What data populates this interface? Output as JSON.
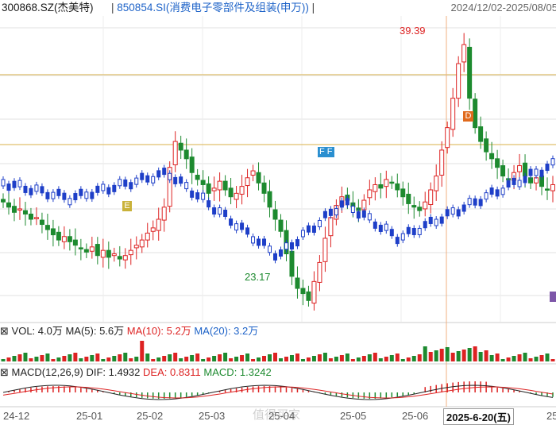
{
  "header": {
    "stock": "300868.SZ(杰美特)",
    "sep1": "|",
    "index": "850854.SI(消费电子零部件及组装(申万))",
    "sep2": "|",
    "range": "2024/12/02-2025/08/05"
  },
  "vol_panel": {
    "label": "VOL: 4.0万",
    "ma5": "MA(5): 5.6万",
    "ma10": "MA(10): 5.2万",
    "ma20": "MA(20): 3.2万",
    "prefix": "⊠"
  },
  "macd_panel": {
    "prefix": "⊠",
    "label": "MACD(12,26,9)",
    "dif": "DIF: 1.4932",
    "dea": "DEA: 0.8311",
    "macd": "MACD: 1.3242"
  },
  "annotations": {
    "high": "39.39",
    "low": "23.17",
    "marker_e": "E",
    "marker_f": "F",
    "marker_d": "D"
  },
  "xaxis": {
    "labels": [
      "24-12",
      "25-01",
      "25-02",
      "25-03",
      "25-04",
      "25-05",
      "25-06",
      "25"
    ],
    "cursor": "2025-6-20(五)"
  },
  "watermark": "值得买家",
  "colors": {
    "up": "#d22",
    "down": "#1d8a2f",
    "index": "#1e3fc8",
    "ref": "#d9b24a",
    "cursor": "#f0b080"
  },
  "chart_data": {
    "type": "candlestick",
    "title": "300868.SZ(杰美特)",
    "date_range": [
      "2024/12/02",
      "2025/08/05"
    ],
    "price_extremes": {
      "high": 39.39,
      "low": 23.17
    },
    "x_ticks": [
      "24-12",
      "25-01",
      "25-02",
      "25-03",
      "25-04",
      "25-05",
      "25-06"
    ],
    "close_estimate": [
      29.5,
      29.2,
      28.9,
      29.1,
      28.8,
      28.5,
      28.6,
      28.2,
      27.9,
      27.6,
      27.3,
      27.5,
      27.2,
      27.0,
      26.8,
      26.6,
      26.9,
      26.4,
      26.7,
      26.3,
      26.5,
      26.2,
      26.4,
      26.7,
      27.0,
      27.3,
      27.7,
      28.0,
      28.5,
      29.2,
      31.5,
      33.0,
      32.5,
      32.0,
      31.2,
      30.8,
      30.5,
      30.0,
      30.3,
      30.7,
      30.2,
      29.8,
      30.0,
      30.4,
      30.9,
      31.3,
      30.6,
      30.0,
      29.2,
      28.5,
      27.8,
      26.5,
      25.2,
      24.5,
      24.2,
      23.8,
      24.9,
      26.0,
      27.4,
      28.6,
      29.3,
      29.8,
      29.6,
      29.2,
      29.0,
      29.6,
      30.2,
      30.5,
      30.3,
      30.8,
      30.6,
      30.2,
      29.8,
      29.4,
      29.2,
      29.0,
      29.5,
      30.2,
      31.0,
      32.5,
      33.8,
      35.5,
      37.5,
      38.6,
      35.5,
      33.8,
      33.0,
      32.4,
      32.0,
      31.5,
      31.0,
      30.8,
      31.2,
      31.6,
      31.0,
      30.6,
      30.9,
      30.4,
      30.2,
      30.5
    ],
    "volume_current": "4.0万",
    "volume_ma": {
      "MA5": "5.6万",
      "MA10": "5.2万",
      "MA20": "3.2万"
    },
    "macd": {
      "params": "12,26,9",
      "DIF": 1.4932,
      "DEA": 0.8311,
      "MACD": 1.3242
    }
  }
}
